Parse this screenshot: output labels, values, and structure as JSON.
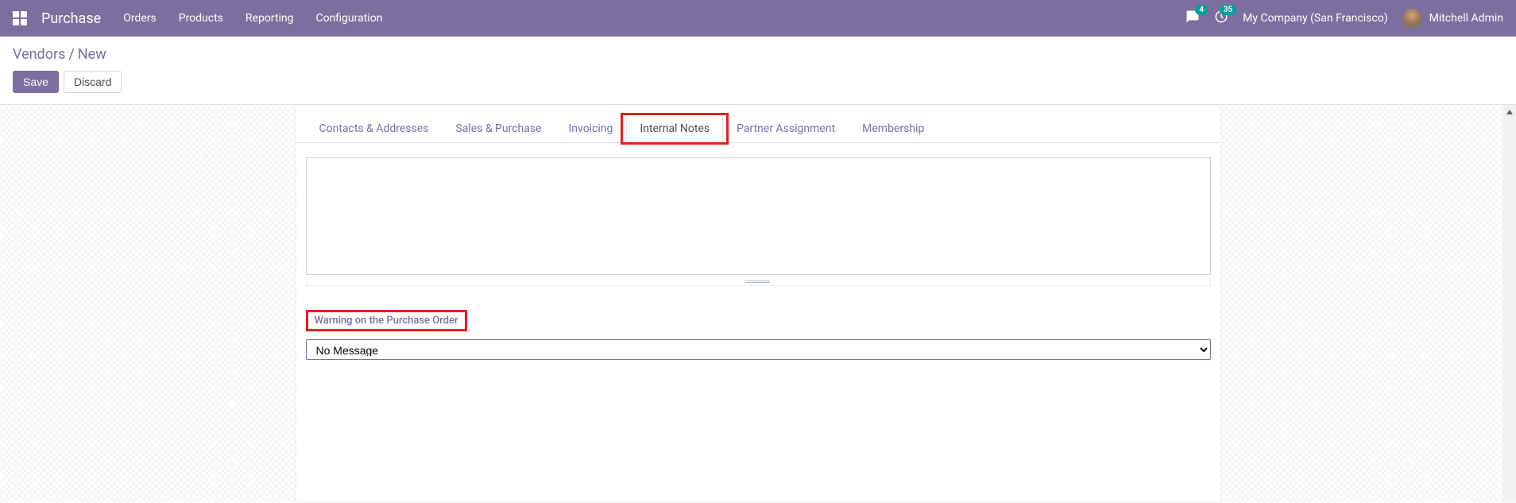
{
  "navbar": {
    "brand": "Purchase",
    "menu": [
      "Orders",
      "Products",
      "Reporting",
      "Configuration"
    ],
    "chat_badge": "4",
    "activity_badge": "35",
    "company": "My Company (San Francisco)",
    "user": "Mitchell Admin"
  },
  "breadcrumb": {
    "parent": "Vendors",
    "current": "New"
  },
  "buttons": {
    "save": "Save",
    "discard": "Discard"
  },
  "tabs": [
    {
      "label": "Contacts & Addresses",
      "active": false
    },
    {
      "label": "Sales & Purchase",
      "active": false
    },
    {
      "label": "Invoicing",
      "active": false
    },
    {
      "label": "Internal Notes",
      "active": true,
      "highlighted": true
    },
    {
      "label": "Partner Assignment",
      "active": false
    },
    {
      "label": "Membership",
      "active": false
    }
  ],
  "form": {
    "notes_value": "",
    "warning_label": "Warning on the Purchase Order",
    "warning_selected": "No Message"
  }
}
